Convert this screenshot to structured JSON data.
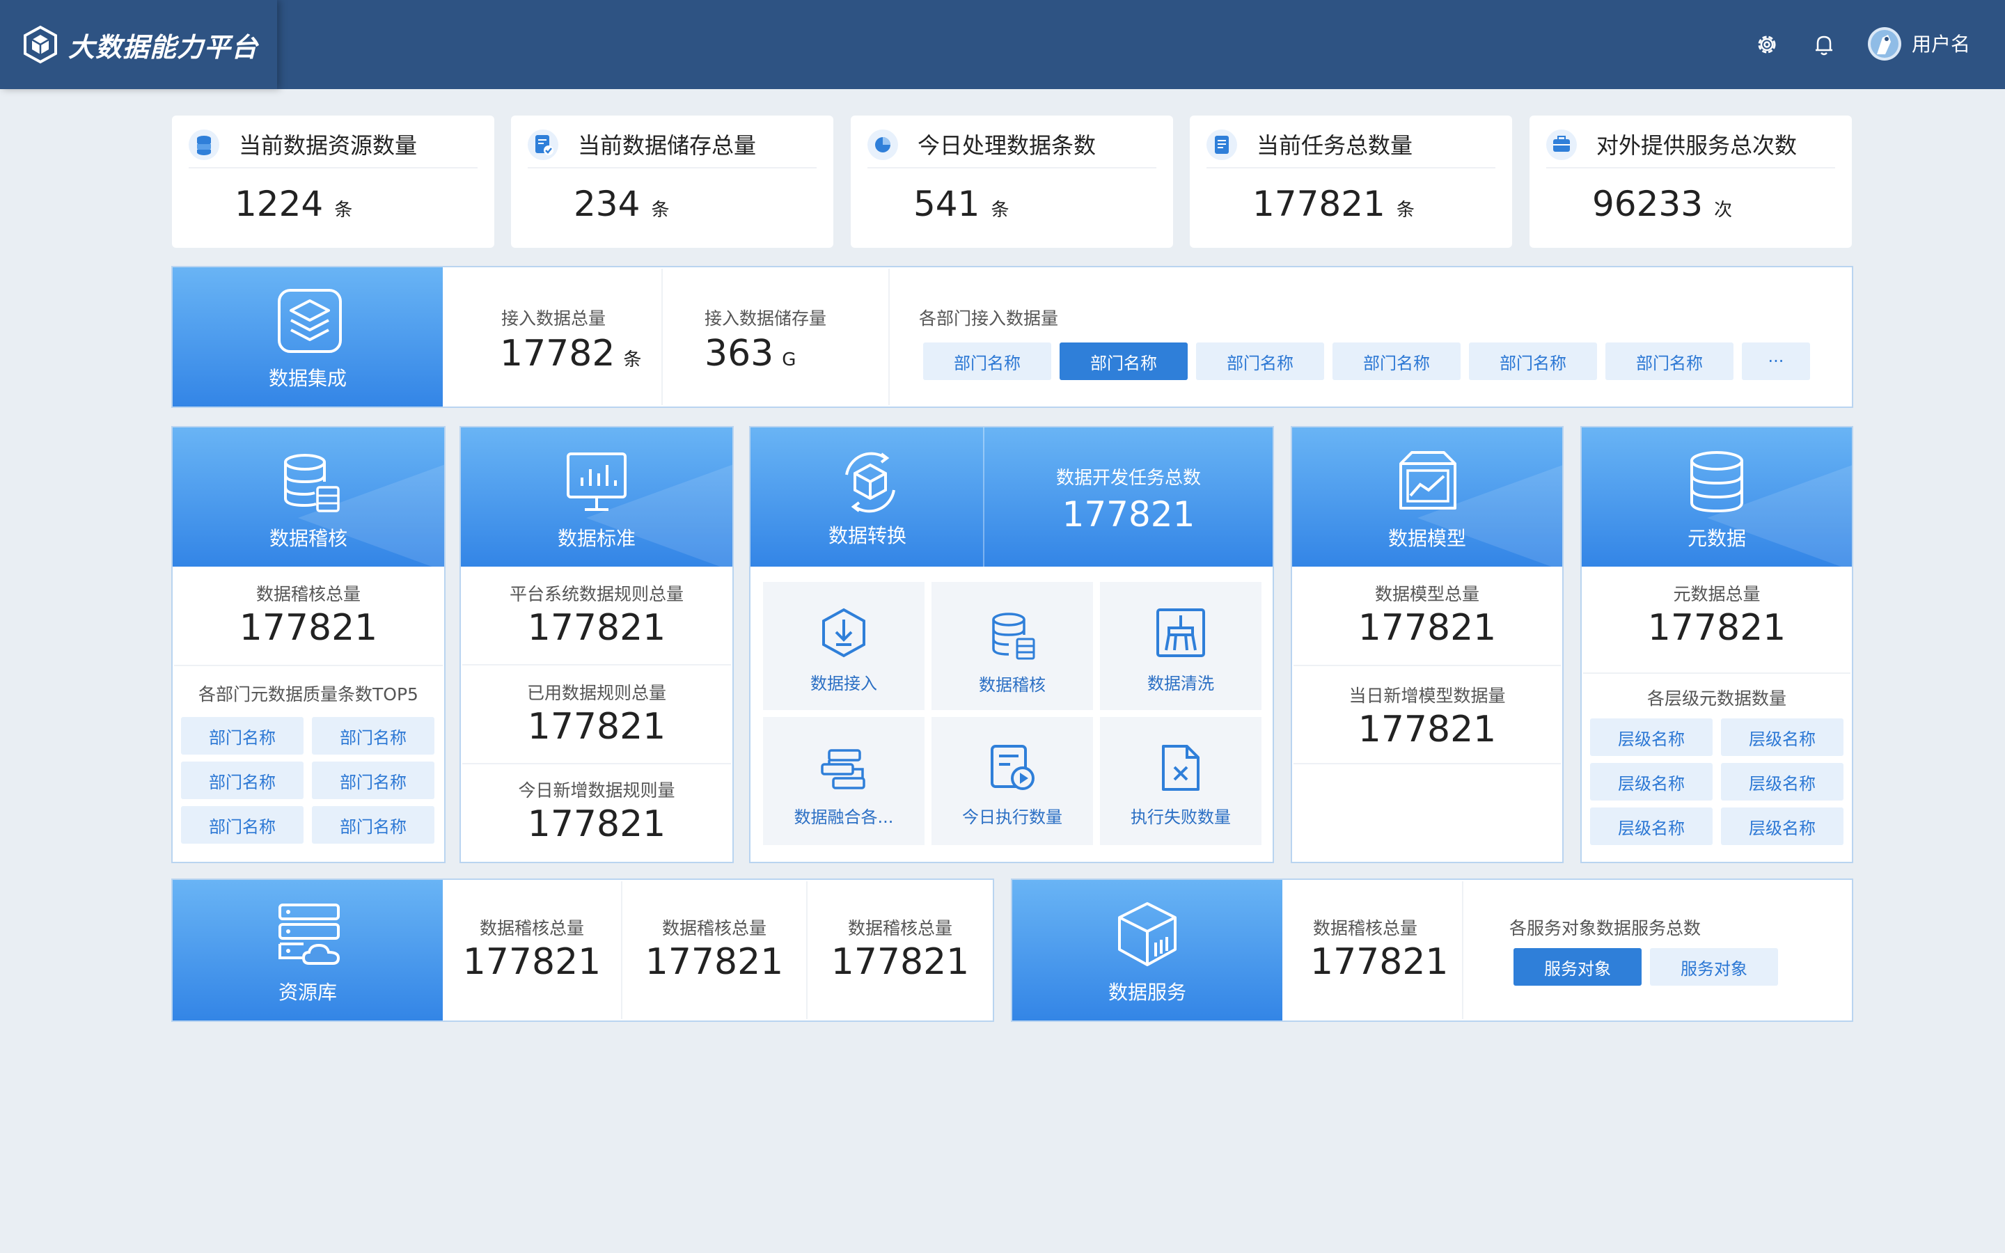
{
  "app": {
    "title": "大数据能力平台",
    "user": "用户名"
  },
  "stats": [
    {
      "title": "当前数据资源数量",
      "value": "1224",
      "unit": "条",
      "icon": "database-icon"
    },
    {
      "title": "当前数据储存总量",
      "value": "234",
      "unit": "条",
      "icon": "document-check-icon"
    },
    {
      "title": "今日处理数据条数",
      "value": "541",
      "unit": "条",
      "icon": "pie-chart-icon"
    },
    {
      "title": "当前任务总数量",
      "value": "177821",
      "unit": "条",
      "icon": "list-document-icon"
    },
    {
      "title": "对外提供服务总次数",
      "value": "96233",
      "unit": "次",
      "icon": "toolbox-icon"
    }
  ],
  "integration": {
    "title": "数据集成",
    "total_label": "接入数据总量",
    "total_value": "17782",
    "total_unit": "条",
    "storage_label": "接入数据储存量",
    "storage_value": "363",
    "storage_unit": "G",
    "dept_label": "各部门接入数据量",
    "depts": [
      "部门名称",
      "部门名称",
      "部门名称",
      "部门名称",
      "部门名称",
      "部门名称"
    ],
    "more": "···"
  },
  "audit": {
    "title": "数据稽核",
    "total_label": "数据稽核总量",
    "total_value": "177821",
    "top_label": "各部门元数据质量条数TOP5",
    "depts": [
      "部门名称",
      "部门名称",
      "部门名称",
      "部门名称",
      "部门名称",
      "部门名称"
    ]
  },
  "standard": {
    "title": "数据标准",
    "rows": [
      {
        "label": "平台系统数据规则总量",
        "value": "177821"
      },
      {
        "label": "已用数据规则总量",
        "value": "177821"
      },
      {
        "label": "今日新增数据规则量",
        "value": "177821"
      }
    ]
  },
  "transform": {
    "title": "数据转换",
    "task_label": "数据开发任务总数",
    "task_value": "177821",
    "tiles": [
      "数据接入",
      "数据稽核",
      "数据清洗",
      "数据融合各...",
      "今日执行数量",
      "执行失败数量"
    ]
  },
  "model": {
    "title": "数据模型",
    "rows": [
      {
        "label": "数据模型总量",
        "value": "177821"
      },
      {
        "label": "当日新增模型数据量",
        "value": "177821"
      }
    ]
  },
  "meta": {
    "title": "元数据",
    "total_label": "元数据总量",
    "total_value": "177821",
    "levels_label": "各层级元数据数量",
    "levels": [
      "层级名称",
      "层级名称",
      "层级名称",
      "层级名称",
      "层级名称",
      "层级名称"
    ]
  },
  "repo": {
    "title": "资源库",
    "items": [
      {
        "label": "数据稽核总量",
        "value": "177821"
      },
      {
        "label": "数据稽核总量",
        "value": "177821"
      },
      {
        "label": "数据稽核总量",
        "value": "177821"
      }
    ]
  },
  "service": {
    "title": "数据服务",
    "total_label": "数据稽核总量",
    "total_value": "177821",
    "targets_label": "各服务对象数据服务总数",
    "targets": [
      "服务对象",
      "服务对象"
    ]
  },
  "colors": {
    "header": "#2e5383",
    "accent": "#2f7fd9",
    "banner_top": "#69b4f5",
    "banner_bottom": "#3385e6",
    "tag_bg": "#e6f0fb"
  }
}
